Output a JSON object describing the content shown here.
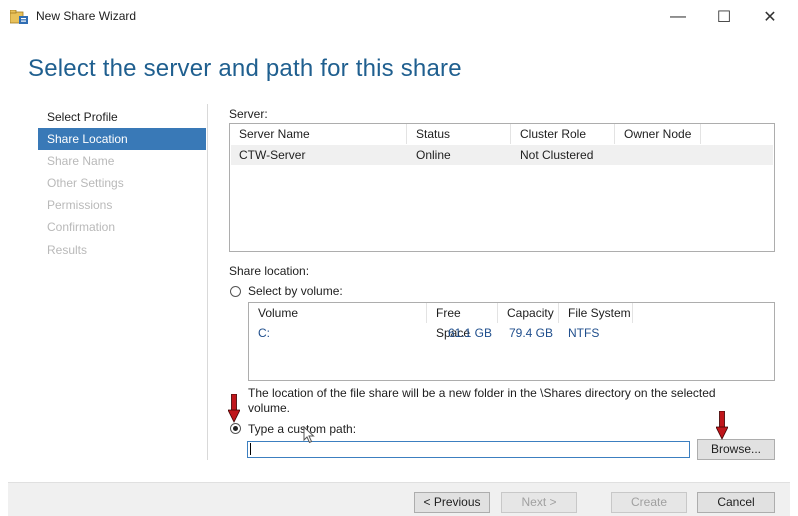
{
  "window": {
    "title": "New Share Wizard",
    "app_icon": "share-folder-icon",
    "minimize_glyph": "—",
    "maximize_glyph": "☐",
    "close_glyph": "✕"
  },
  "heading": "Select the server and path for this share",
  "nav": {
    "items": [
      {
        "label": "Select Profile",
        "state": "done"
      },
      {
        "label": "Share Location",
        "state": "current"
      },
      {
        "label": "Share Name",
        "state": "disabled"
      },
      {
        "label": "Other Settings",
        "state": "disabled"
      },
      {
        "label": "Permissions",
        "state": "disabled"
      },
      {
        "label": "Confirmation",
        "state": "disabled"
      },
      {
        "label": "Results",
        "state": "disabled"
      }
    ]
  },
  "server": {
    "label": "Server:",
    "columns": [
      "Server Name",
      "Status",
      "Cluster Role",
      "Owner Node"
    ],
    "rows": [
      [
        "CTW-Server",
        "Online",
        "Not Clustered",
        ""
      ]
    ]
  },
  "share_location": {
    "label": "Share location:",
    "by_volume_label": "Select by volume:",
    "volume_columns": [
      "Volume",
      "Free Space",
      "Capacity",
      "File System"
    ],
    "volume_rows": [
      [
        "C:",
        "61.1 GB",
        "79.4 GB",
        "NTFS"
      ]
    ],
    "note": "The location of the file share will be a new folder in the \\Shares directory on the selected volume.",
    "custom_path_label": "Type a custom path:",
    "custom_path_value": "",
    "selected_option": "custom_path"
  },
  "buttons": {
    "browse": "Browse...",
    "previous": "< Previous",
    "next": "Next >",
    "create": "Create",
    "cancel": "Cancel"
  },
  "colors": {
    "heading": "#1f5f8f",
    "nav_current_bg": "#3979b7",
    "volume_text": "#1f4e8c",
    "annotation_arrow": "#c0161b"
  }
}
